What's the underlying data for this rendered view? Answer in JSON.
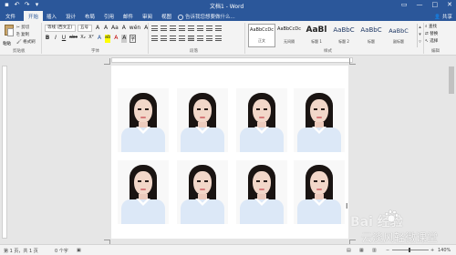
{
  "titlebar": {
    "title": "文档1 - Word",
    "qat": [
      "save-icon",
      "undo-icon",
      "redo-icon",
      "customize-icon"
    ],
    "controls": [
      "ribbon-options-icon",
      "minimize-icon",
      "maximize-icon",
      "close-icon"
    ]
  },
  "tabs": {
    "items": [
      "文件",
      "开始",
      "插入",
      "设计",
      "布局",
      "引用",
      "邮件",
      "审阅",
      "视图"
    ],
    "active": "开始",
    "tellme": "告诉我您想要做什么...",
    "share": "共享"
  },
  "ribbon": {
    "clipboard": {
      "paste": "粘贴",
      "cut": "剪切",
      "copy": "复制",
      "format_painter": "格式刷",
      "label": "剪贴板"
    },
    "font": {
      "family": "等线 (西文正)",
      "size": "五号",
      "label": "字体",
      "row1": [
        "A",
        "A",
        "Aa",
        "A",
        "wén",
        "A"
      ],
      "row2": [
        "B",
        "I",
        "U",
        "abc",
        "X₂",
        "X²",
        "A",
        "ab",
        "A",
        "A",
        "字"
      ]
    },
    "paragraph": {
      "label": "段落"
    },
    "styles": {
      "label": "样式",
      "items": [
        {
          "sample": "AaBbCcDc",
          "name": "正文"
        },
        {
          "sample": "AaBbCcDc",
          "name": "无间隔"
        },
        {
          "sample": "AaBl",
          "name": "标题 1"
        },
        {
          "sample": "AaBbC",
          "name": "标题 2"
        },
        {
          "sample": "AaBbC",
          "name": "标题"
        },
        {
          "sample": "AaBbC",
          "name": "副标题"
        }
      ]
    },
    "editing": {
      "find": "查找",
      "replace": "替换",
      "select": "选择",
      "label": "编辑"
    }
  },
  "statusbar": {
    "page": "第 1 页，共 1 页",
    "words": "0 个字",
    "zoom": "140%"
  },
  "watermark": {
    "logo": "Bai 经验",
    "text": "云淡风轻微课堂"
  },
  "colors": {
    "title_bar": "#2b579a",
    "ribbon_bg": "#f3f3f3",
    "canvas_bg": "#e6e6e6",
    "shirt": "#dce8f7"
  }
}
